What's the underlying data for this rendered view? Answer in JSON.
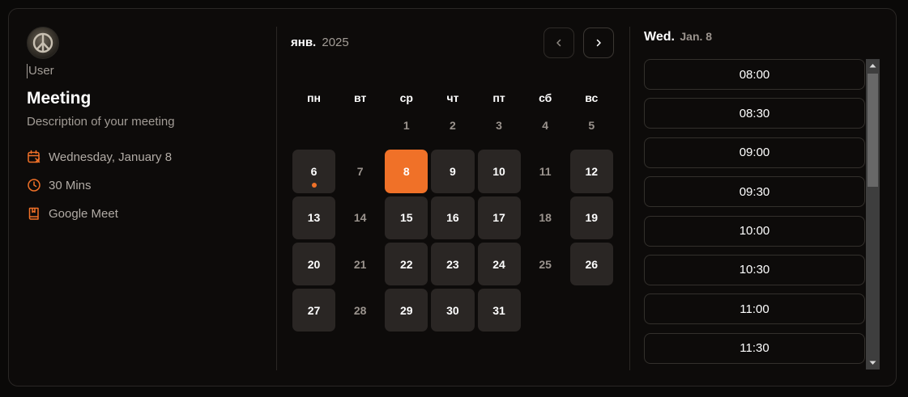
{
  "user": {
    "name": "User",
    "avatar": "peace-sign-avatar"
  },
  "meeting": {
    "title": "Meeting",
    "description": "Description of your meeting",
    "details": [
      {
        "icon": "calendar-x-icon",
        "label": "Wednesday, January 8"
      },
      {
        "icon": "clock-icon",
        "label": "30 Mins"
      },
      {
        "icon": "book-icon",
        "label": "Google Meet"
      }
    ]
  },
  "calendar": {
    "month": "янв.",
    "year": "2025",
    "weekdays": [
      "пн",
      "вт",
      "ср",
      "чт",
      "пт",
      "сб",
      "вс"
    ],
    "leading_blanks": 2,
    "days": [
      {
        "day": "1",
        "state": "plain"
      },
      {
        "day": "2",
        "state": "plain"
      },
      {
        "day": "3",
        "state": "plain"
      },
      {
        "day": "4",
        "state": "plain"
      },
      {
        "day": "5",
        "state": "plain"
      },
      {
        "day": "6",
        "state": "available",
        "today": true
      },
      {
        "day": "7",
        "state": "plain"
      },
      {
        "day": "8",
        "state": "selected"
      },
      {
        "day": "9",
        "state": "available"
      },
      {
        "day": "10",
        "state": "available"
      },
      {
        "day": "11",
        "state": "plain"
      },
      {
        "day": "12",
        "state": "available"
      },
      {
        "day": "13",
        "state": "available"
      },
      {
        "day": "14",
        "state": "plain"
      },
      {
        "day": "15",
        "state": "available"
      },
      {
        "day": "16",
        "state": "available"
      },
      {
        "day": "17",
        "state": "available"
      },
      {
        "day": "18",
        "state": "plain"
      },
      {
        "day": "19",
        "state": "available"
      },
      {
        "day": "20",
        "state": "available"
      },
      {
        "day": "21",
        "state": "plain"
      },
      {
        "day": "22",
        "state": "available"
      },
      {
        "day": "23",
        "state": "available"
      },
      {
        "day": "24",
        "state": "available"
      },
      {
        "day": "25",
        "state": "plain"
      },
      {
        "day": "26",
        "state": "available"
      },
      {
        "day": "27",
        "state": "available"
      },
      {
        "day": "28",
        "state": "plain"
      },
      {
        "day": "29",
        "state": "available"
      },
      {
        "day": "30",
        "state": "available"
      },
      {
        "day": "31",
        "state": "available"
      }
    ]
  },
  "slots_panel": {
    "weekday": "Wed.",
    "date": "Jan. 8",
    "times": [
      "08:00",
      "08:30",
      "09:00",
      "09:30",
      "10:00",
      "10:30",
      "11:00",
      "11:30"
    ]
  },
  "colors": {
    "accent": "#f07128",
    "background": "#0a0908",
    "available_day": "#2a2624",
    "muted_text": "#a29c96"
  }
}
